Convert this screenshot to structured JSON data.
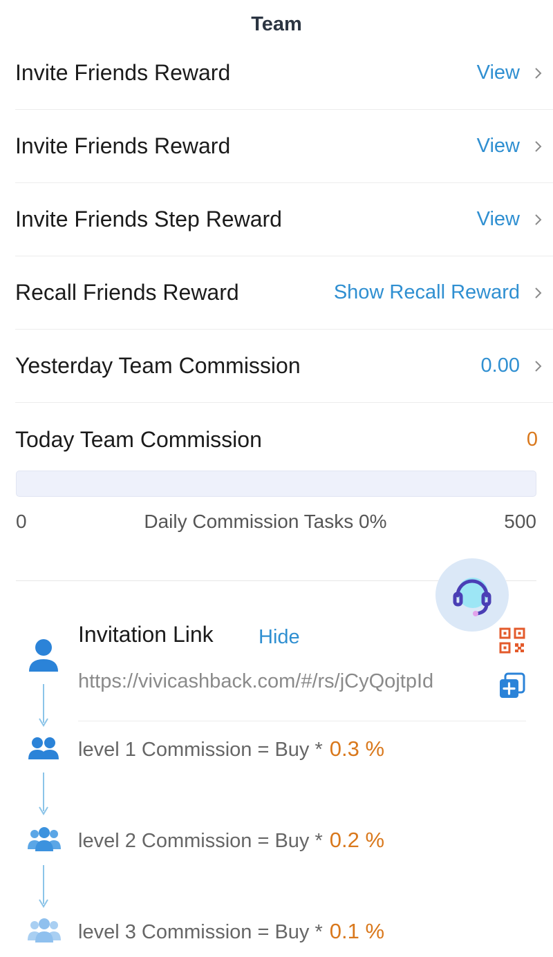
{
  "header": {
    "title": "Team"
  },
  "rows": [
    {
      "label": "Invite Friends Reward",
      "action": "View"
    },
    {
      "label": "Invite Friends Reward",
      "action": "View"
    },
    {
      "label": "Invite Friends Step Reward",
      "action": "View"
    },
    {
      "label": "Recall Friends Reward",
      "action": "Show Recall Reward"
    },
    {
      "label": "Yesterday Team Commission",
      "action": "0.00"
    },
    {
      "label": "Today Team Commission",
      "value": "0"
    }
  ],
  "progress": {
    "min": "0",
    "max": "500",
    "label": "Daily Commission Tasks 0%",
    "fraction": 0
  },
  "invitation": {
    "title": "Invitation Link",
    "hide": "Hide",
    "url": "https://vivicashback.com/#/rs/jCyQojtpId"
  },
  "levels": [
    {
      "text": "level 1 Commission = Buy *",
      "rate": "0.3 %"
    },
    {
      "text": "level 2 Commission = Buy *",
      "rate": "0.2 %"
    },
    {
      "text": "level 3 Commission = Buy *",
      "rate": "0.1 %"
    }
  ],
  "icons": {
    "support": "headset-icon",
    "qr": "qr-code-icon",
    "copy": "copy-icon",
    "user": "user-icon",
    "level1": "two-users-icon",
    "level2": "group-icon",
    "level3": "group-icon"
  },
  "colors": {
    "link": "#2f8fd1",
    "accent": "#d9781c",
    "icon_blue": "#2b83d8"
  }
}
